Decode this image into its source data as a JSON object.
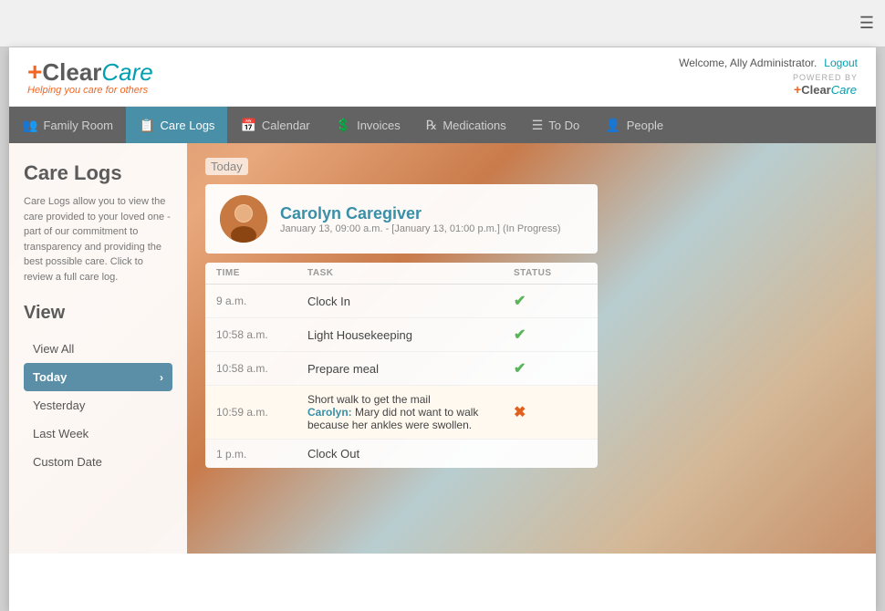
{
  "browser": {
    "hamburger": "☰"
  },
  "header": {
    "logo_plus": "+",
    "logo_clear": "Clear",
    "logo_care": "Care",
    "tagline": "Helping you care for others",
    "welcome": "Welcome, Ally Administrator.",
    "logout": "Logout",
    "powered_by_text": "POWERED BY",
    "powered_plus": "+",
    "powered_clear": "Clear",
    "powered_care": "Care"
  },
  "nav": {
    "items": [
      {
        "id": "family-room",
        "label": "Family Room",
        "icon": "👥"
      },
      {
        "id": "care-logs",
        "label": "Care Logs",
        "icon": "📋",
        "active": true
      },
      {
        "id": "calendar",
        "label": "Calendar",
        "icon": "📅"
      },
      {
        "id": "invoices",
        "label": "Invoices",
        "icon": "💲"
      },
      {
        "id": "medications",
        "label": "Medications",
        "icon": "℞"
      },
      {
        "id": "to-do",
        "label": "To Do",
        "icon": "☰"
      },
      {
        "id": "people",
        "label": "People",
        "icon": "👤"
      }
    ]
  },
  "sidebar": {
    "title": "Care Logs",
    "description": "Care Logs allow you to view the care provided to your loved one - part of our commitment to transparency and providing the best possible care. Click to review a full care log.",
    "view_section": "View",
    "menu_items": [
      {
        "label": "View All",
        "active": false
      },
      {
        "label": "Today",
        "active": true,
        "has_chevron": true
      },
      {
        "label": "Yesterday",
        "active": false
      },
      {
        "label": "Last Week",
        "active": false
      },
      {
        "label": "Custom Date",
        "active": false
      }
    ]
  },
  "content": {
    "today_label": "Today",
    "caregiver": {
      "name": "Carolyn Caregiver",
      "date_range": "January 13, 09:00 a.m. - [January 13, 01:00 p.m.] (In Progress)"
    },
    "table": {
      "headers": [
        "TIME",
        "TASK",
        "STATUS"
      ],
      "rows": [
        {
          "time": "9 a.m.",
          "task": "Clock In",
          "status": "check",
          "highlighted": false
        },
        {
          "time": "10:58 a.m.",
          "task": "Light Housekeeping",
          "status": "check",
          "highlighted": false
        },
        {
          "time": "10:58 a.m.",
          "task": "Prepare meal",
          "status": "check",
          "highlighted": false
        },
        {
          "time": "10:59 a.m.",
          "task": "Short walk to get the mail",
          "note": "Carolyn: Mary did not want to walk because her ankles were swollen.",
          "status": "x",
          "highlighted": true
        },
        {
          "time": "1 p.m.",
          "task": "Clock Out",
          "status": "",
          "highlighted": false
        }
      ]
    }
  }
}
